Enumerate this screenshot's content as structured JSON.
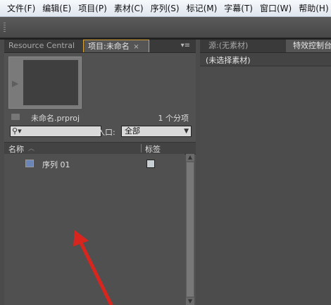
{
  "menubar": {
    "items": [
      "文件(F)",
      "编辑(E)",
      "项目(P)",
      "素材(C)",
      "序列(S)",
      "标记(M)",
      "字幕(T)",
      "窗口(W)",
      "帮助(H)"
    ]
  },
  "left_panel": {
    "tabs": {
      "resource_central": "Resource Central",
      "project": "项目:未命名",
      "close": "×",
      "menu": "▾≡"
    },
    "project_file": "未命名.prproj",
    "item_count": "1 个分项",
    "search": {
      "icon": "search-icon",
      "dropdown": "▾"
    },
    "entry": {
      "label": "入口:",
      "value": "全部",
      "arrow": "▼"
    },
    "columns": {
      "name": "名称",
      "sort": "︿",
      "label": "标签"
    },
    "items": [
      {
        "name": "序列 01",
        "icon": "sequence-icon",
        "label_color": "#c8d0d3"
      }
    ]
  },
  "right_panel": {
    "tabs": {
      "source": "源:(无素材)",
      "effect_controls": "特效控制台"
    },
    "header": "(未选择素材)"
  },
  "colors": {
    "annotation_arrow": "#d8261e",
    "active_tab_border": "#d7a33a"
  }
}
